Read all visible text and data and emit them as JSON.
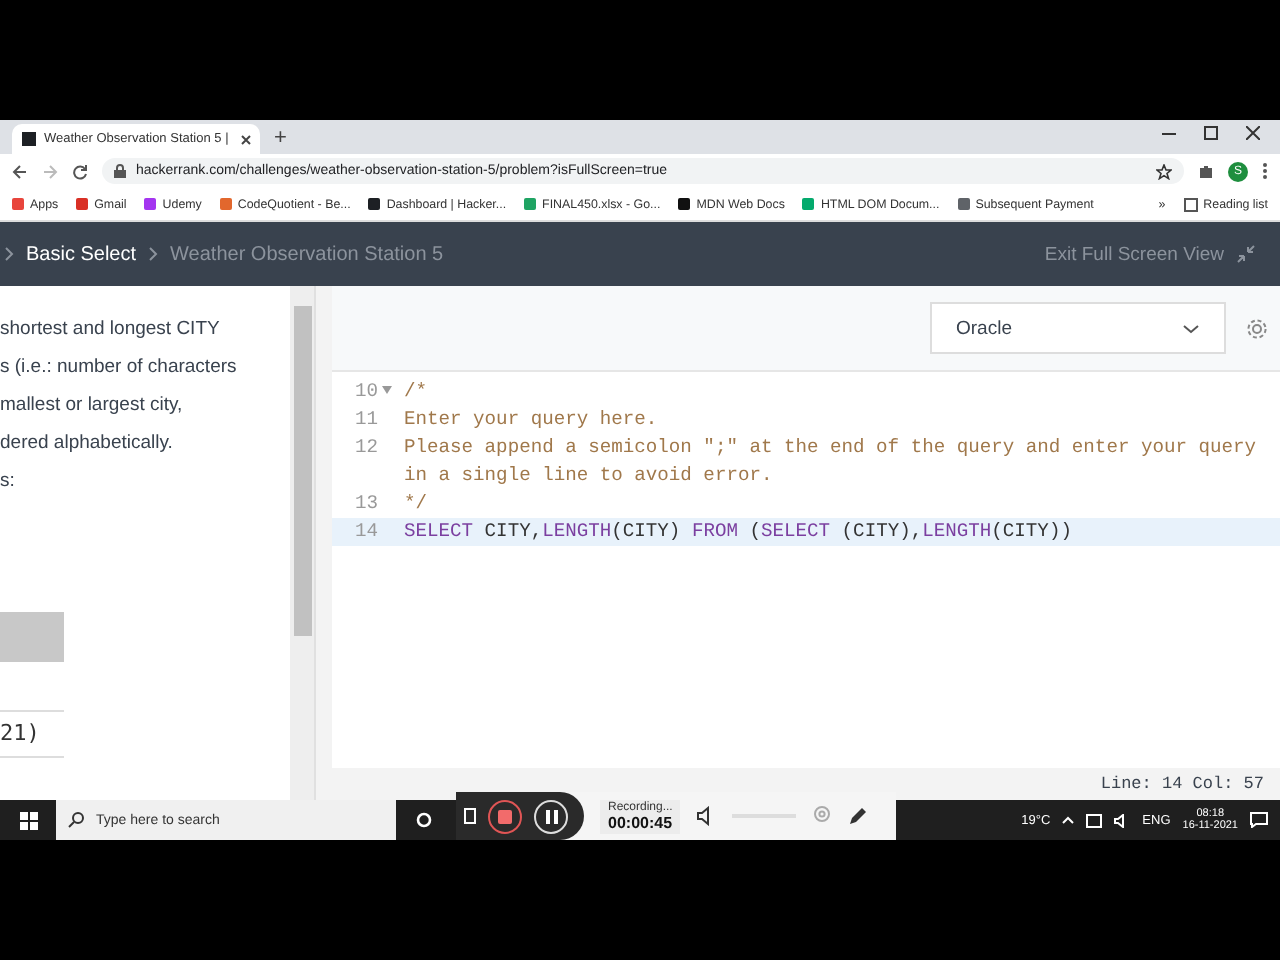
{
  "browser": {
    "tabs": [
      {
        "title": "Weather Observation Station 5 | ",
        "selected": true
      }
    ],
    "new_tab": "+",
    "url": "hackerrank.com/challenges/weather-observation-station-5/problem?isFullScreen=true",
    "profile": "S",
    "bookmarks": [
      {
        "label": "Apps",
        "color": "#e8453c"
      },
      {
        "label": "Gmail",
        "color": "#d93025"
      },
      {
        "label": "Udemy",
        "color": "#a435f0"
      },
      {
        "label": "CodeQuotient - Be...",
        "color": "#e2672d"
      },
      {
        "label": "Dashboard | Hacker...",
        "color": "#1d2024"
      },
      {
        "label": "FINAL450.xlsx - Go...",
        "color": "#1fa463"
      },
      {
        "label": "MDN Web Docs",
        "color": "#111111"
      },
      {
        "label": "HTML DOM Docum...",
        "color": "#04aa6d"
      },
      {
        "label": "Subsequent Payment",
        "color": "#5f6368"
      }
    ],
    "more": "»",
    "reading_list": "Reading list"
  },
  "header": {
    "breadcrumbs": [
      {
        "label": "Basic Select",
        "current": true
      },
      {
        "label": "Weather Observation Station 5",
        "current": false
      }
    ],
    "exit": "Exit Full Screen View"
  },
  "problem": {
    "lines": [
      "shortest and longest CITY",
      "s (i.e.: number of characters",
      "mallest or largest city,",
      "dered alphabetically.",
      "s:"
    ],
    "table_cell": "21)"
  },
  "editor": {
    "language": "Oracle",
    "lines": [
      {
        "number": "10",
        "fold": true,
        "highlighted": false,
        "segments": [
          {
            "kind": "comment",
            "text": "/*"
          }
        ]
      },
      {
        "number": "11",
        "fold": false,
        "highlighted": false,
        "segments": [
          {
            "kind": "comment",
            "text": "Enter your query here."
          }
        ]
      },
      {
        "number": "12",
        "fold": false,
        "highlighted": false,
        "segments": [
          {
            "kind": "comment",
            "text": "Please append a semicolon \";\" at the end of the query and enter your query in a single line to avoid error."
          }
        ]
      },
      {
        "number": "13",
        "fold": false,
        "highlighted": false,
        "segments": [
          {
            "kind": "comment",
            "text": "*/"
          }
        ]
      },
      {
        "number": "14",
        "fold": false,
        "highlighted": true,
        "segments": [
          {
            "kind": "keyword",
            "text": "SELECT"
          },
          {
            "kind": "plain",
            "text": " CITY,"
          },
          {
            "kind": "keyword",
            "text": "LENGTH"
          },
          {
            "kind": "plain",
            "text": "(CITY) "
          },
          {
            "kind": "keyword",
            "text": "FROM"
          },
          {
            "kind": "plain",
            "text": " ("
          },
          {
            "kind": "keyword",
            "text": "SELECT"
          },
          {
            "kind": "plain",
            "text": " (CITY),"
          },
          {
            "kind": "keyword",
            "text": "LENGTH"
          },
          {
            "kind": "plain",
            "text": "(CITY))"
          }
        ]
      }
    ],
    "status": "Line: 14 Col: 57"
  },
  "taskbar": {
    "search_placeholder": "Type here to search",
    "recorder": {
      "status": "Recording...",
      "time": "00:00:45"
    },
    "temperature": "19°C",
    "language": "ENG",
    "time": "08:18",
    "date": "16-11-2021"
  }
}
